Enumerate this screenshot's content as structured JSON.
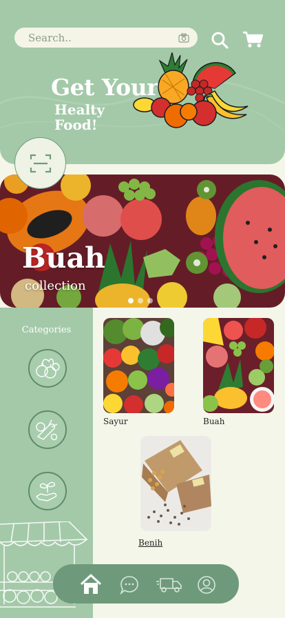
{
  "header": {
    "search_placeholder": "Search..",
    "hero_title": "Get Your",
    "hero_subtitle": "Healty Food!",
    "icons": [
      "camera-icon",
      "search-icon",
      "cart-icon"
    ]
  },
  "banner": {
    "title": "Buah",
    "subtitle": "collection",
    "slides_total": 3,
    "active_slide": 1
  },
  "sidebar": {
    "title": "Categories",
    "items": [
      {
        "icon": "fruits-basket-icon"
      },
      {
        "icon": "vegetables-icon"
      },
      {
        "icon": "hand-seedling-icon"
      }
    ]
  },
  "products": [
    {
      "label": "Sayur"
    },
    {
      "label": "Buah"
    },
    {
      "label": "Benih "
    }
  ],
  "nav": {
    "items": [
      "home-icon",
      "chat-icon",
      "delivery-truck-icon",
      "profile-icon"
    ],
    "active": "home-icon"
  },
  "colors": {
    "accent": "#a3c9a9",
    "nav": "#6e9a7b",
    "background": "#f5f6ea"
  }
}
